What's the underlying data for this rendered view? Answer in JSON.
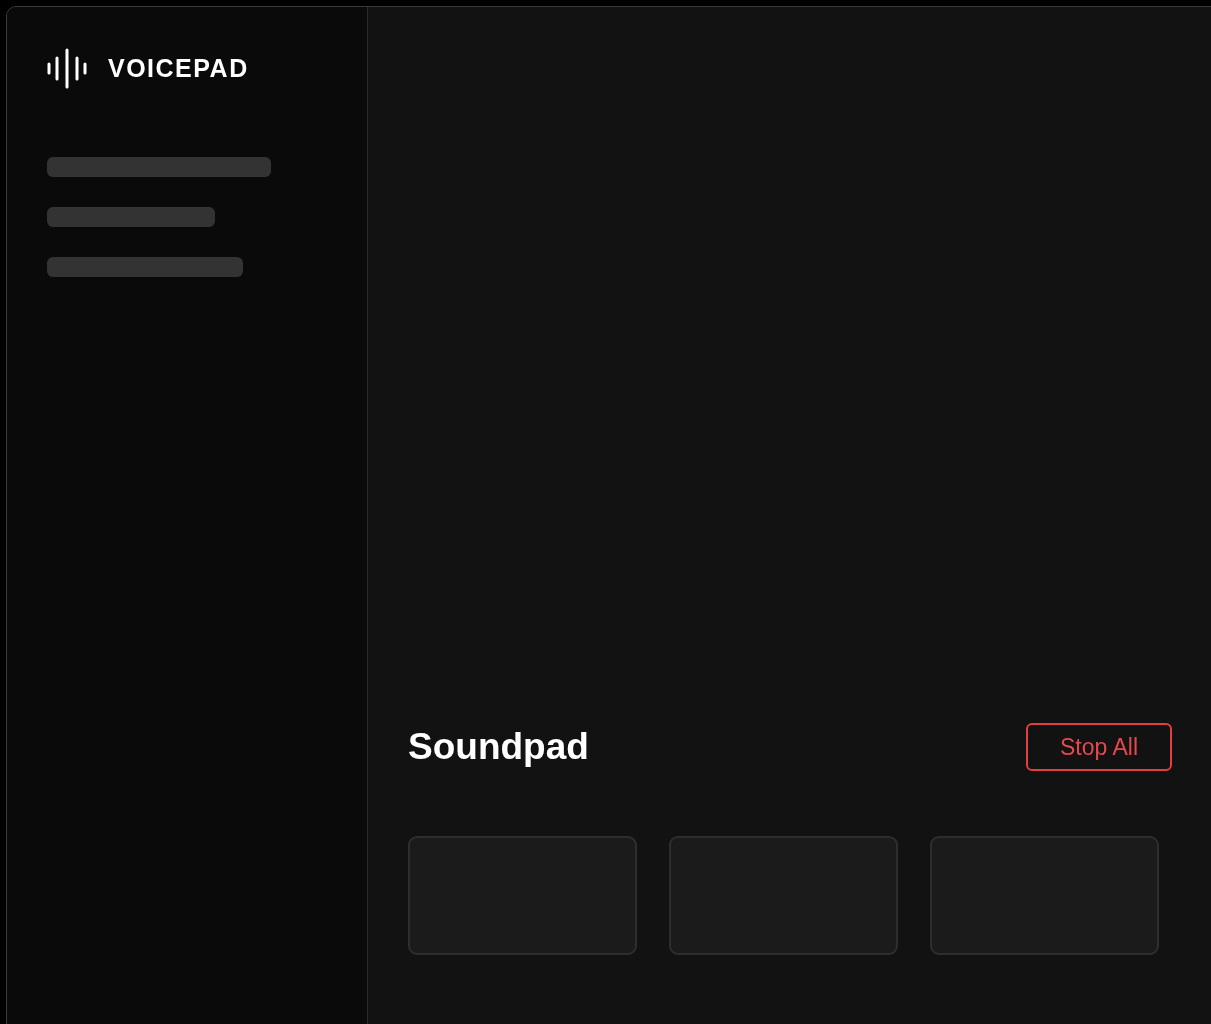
{
  "brand": {
    "name": "VOICEPAD"
  },
  "sidebar": {
    "items": [
      {
        "kind": "placeholder"
      },
      {
        "kind": "placeholder"
      },
      {
        "kind": "placeholder"
      }
    ]
  },
  "soundpad": {
    "title": "Soundpad",
    "stop_button": "Stop All",
    "pads": [
      {
        "kind": "empty"
      },
      {
        "kind": "empty"
      },
      {
        "kind": "empty"
      }
    ]
  }
}
